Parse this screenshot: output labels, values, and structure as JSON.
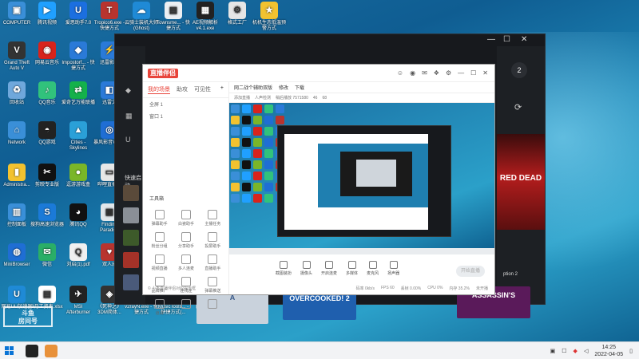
{
  "desktop": {
    "icons": [
      {
        "label": "COMPUTER",
        "icon": "computer-icon",
        "color": "#3a8fd8",
        "glyph": "▣"
      },
      {
        "label": "腾讯视频",
        "icon": "tencent-video-icon",
        "color": "#20a0ff",
        "glyph": "▶"
      },
      {
        "label": "爱思助手7.0",
        "icon": "i4-assistant-icon",
        "color": "#1b6fe0",
        "glyph": "U"
      },
      {
        "label": "Tropico6.exe - 快捷方式",
        "icon": "tropico-icon",
        "color": "#b8342f",
        "glyph": "T"
      },
      {
        "label": "云骑士装机大师(Ghost)",
        "icon": "yunqishi-icon",
        "color": "#1f8ad6",
        "glyph": "☁"
      },
      {
        "label": "Townsme... - 快捷方式",
        "icon": "townsmen-icon",
        "color": "#eceff2",
        "glyph": "▤"
      },
      {
        "label": "AE视频解析v4.1.exe",
        "icon": "ae-video-icon",
        "color": "#222222",
        "glyph": "▦"
      },
      {
        "label": "格式工厂",
        "icon": "format-factory-icon",
        "color": "#e6e6e6",
        "glyph": "⚙"
      },
      {
        "label": "机机生态低温预警方式",
        "icon": "app-icon",
        "color": "#f2c230",
        "glyph": "★"
      },
      {
        "label": "Grand Theft Auto V",
        "icon": "gta-icon",
        "color": "#333333",
        "glyph": "V"
      },
      {
        "label": "网易云音乐",
        "icon": "netease-music-icon",
        "color": "#d8231c",
        "glyph": "◉"
      },
      {
        "label": "Impostorf... - 快捷方式",
        "icon": "impostor-icon",
        "color": "#2a7ad8",
        "glyph": "◆"
      },
      {
        "label": "迅雷影音",
        "icon": "xunlei-icon",
        "color": "#2a7ad8",
        "glyph": "⚡"
      },
      {
        "label": "回收站",
        "icon": "recycle-bin-icon",
        "color": "#6fa8dc",
        "glyph": "♻"
      },
      {
        "label": "QQ音乐",
        "icon": "qq-music-icon",
        "color": "#31c27c",
        "glyph": "♪"
      },
      {
        "label": "爱奇艺万能联播",
        "icon": "iqiyi-icon",
        "color": "#14b14b",
        "glyph": "⇄"
      },
      {
        "label": "迅雷文",
        "icon": "xunlei-doc-icon",
        "color": "#2a7ad8",
        "glyph": "◧"
      },
      {
        "label": "Network",
        "icon": "network-icon",
        "color": "#3a8fd8",
        "glyph": "⌂"
      },
      {
        "label": "QQ游戏",
        "icon": "qq-game-icon",
        "color": "#222222",
        "glyph": "◓"
      },
      {
        "label": "Cities - Skylines",
        "icon": "cities-skylines-icon",
        "color": "#2aa0d8",
        "glyph": "▲"
      },
      {
        "label": "暴风影音V17.0",
        "icon": "baofeng-icon",
        "color": "#1f6ed4",
        "glyph": "◎"
      },
      {
        "label": "Administra...",
        "icon": "user-folder-icon",
        "color": "#f2c230",
        "glyph": "▮"
      },
      {
        "label": "剪映专业版",
        "icon": "capcut-icon",
        "color": "#111111",
        "glyph": "✂"
      },
      {
        "label": "逗游游戏盒",
        "icon": "douyou-icon",
        "color": "#7ab629",
        "glyph": "●"
      },
      {
        "label": "哔哩直播姬",
        "icon": "bilibili-live-icon",
        "color": "#e7e7e7",
        "glyph": "▭"
      },
      {
        "label": "控制面板",
        "icon": "control-panel-icon",
        "color": "#3a8fd8",
        "glyph": "▥"
      },
      {
        "label": "搜狗高速浏览器",
        "icon": "sogou-browser-icon",
        "color": "#1b7ad8",
        "glyph": "S"
      },
      {
        "label": "腾讯QQ",
        "icon": "qq-icon",
        "color": "#111111",
        "glyph": "◕"
      },
      {
        "label": "Finding Paradise",
        "icon": "finding-paradise-icon",
        "color": "#e1e6ea",
        "glyph": "▦"
      },
      {
        "label": "MiniBrowser",
        "icon": "minibrowser-icon",
        "color": "#1f6ed4",
        "glyph": "◍"
      },
      {
        "label": "微信",
        "icon": "wechat-icon",
        "color": "#2aae67",
        "glyph": "✉"
      },
      {
        "label": "刘启(1).pdf",
        "icon": "pdf-icon",
        "color": "#f0f0f0",
        "glyph": "Q"
      },
      {
        "label": "双人成",
        "icon": "it-takes-two-icon",
        "color": "#b8342f",
        "glyph": "♥"
      },
      {
        "label": "网易UU加速器",
        "icon": "uu-accelerator-icon",
        "color": "#1f8ad6",
        "glyph": "U"
      },
      {
        "label": "3月工资表.xlsx",
        "icon": "excel-icon",
        "color": "#ffffff",
        "glyph": "▤"
      },
      {
        "label": "MSI Afterburner",
        "icon": "msi-afterburner-icon",
        "color": "#222222",
        "glyph": "✈"
      },
      {
        "label": "《死神之》3DM简体...",
        "icon": "game-icon",
        "color": "#333333",
        "glyph": "◈"
      },
      {
        "label": "v2rayN.exe - 快捷方式",
        "icon": "v2rayn-icon",
        "color": "#1f6ed4",
        "glyph": "V"
      },
      {
        "label": "MusicTools... - 快捷方式(...",
        "icon": "music-tools-icon",
        "color": "#f0f0f0",
        "glyph": "♫"
      },
      {
        "label": "网易云盘",
        "icon": "netease-cloud-drive-icon",
        "color": "#4ea7f0",
        "glyph": "☁"
      },
      {
        "label": "ttTremake... - 快捷方式",
        "icon": "tremake-icon",
        "color": "#eeeeee",
        "glyph": "▣"
      }
    ]
  },
  "dark_window": {
    "controls": {
      "minimize": "—",
      "maximize": "☐",
      "close": "✕"
    },
    "badge": "2",
    "quick_start_label": "快速启动",
    "option_label": "ption 2",
    "rdr_label": "RED DEAD",
    "overcooked_label": "OVERCOOKED! 2",
    "assassin_label": "ASSASSIN'S",
    "a_label": "A"
  },
  "app": {
    "logo": "直播伴侣",
    "tabs": [
      "我的场景",
      "助攻",
      "可见性"
    ],
    "active_tab": "我的场景",
    "scenes": [
      "全屏 1",
      "窗口 1"
    ],
    "toolbox_title": "工具箱",
    "tools": [
      "弹幕助手",
      "白瓷助手",
      "主播任务",
      "粉丝分组",
      "分享助手",
      "投屏助手",
      "视频直播",
      "多人连麦",
      "直播助手",
      "品牌推广",
      "连线连",
      "弹幕推送",
      "道具",
      "",
      ""
    ],
    "bottom_note": "© 小香直播伴侣对应提示框",
    "main_head": [
      "网二战个辅助双版",
      "修改",
      "下载"
    ],
    "main_sub": [
      "添加直播",
      "人声检测",
      "稍后播放 7571580",
      "46",
      "68"
    ],
    "controls": [
      "截图装扮",
      "摄像头",
      "开启连麦",
      "多媒体",
      "麦克风",
      "扬声器"
    ],
    "start_live": "开始直播",
    "status": [
      "码率 0kb/s",
      "FPS 60",
      "丢帧 0.00%",
      "CPU 0%",
      "内存 35.2%",
      "未开播"
    ]
  },
  "watermark": {
    "line1": "斗鱼",
    "line2": "房间号"
  },
  "taskbar": {
    "time": "14:25",
    "date": "2022-04-05"
  }
}
